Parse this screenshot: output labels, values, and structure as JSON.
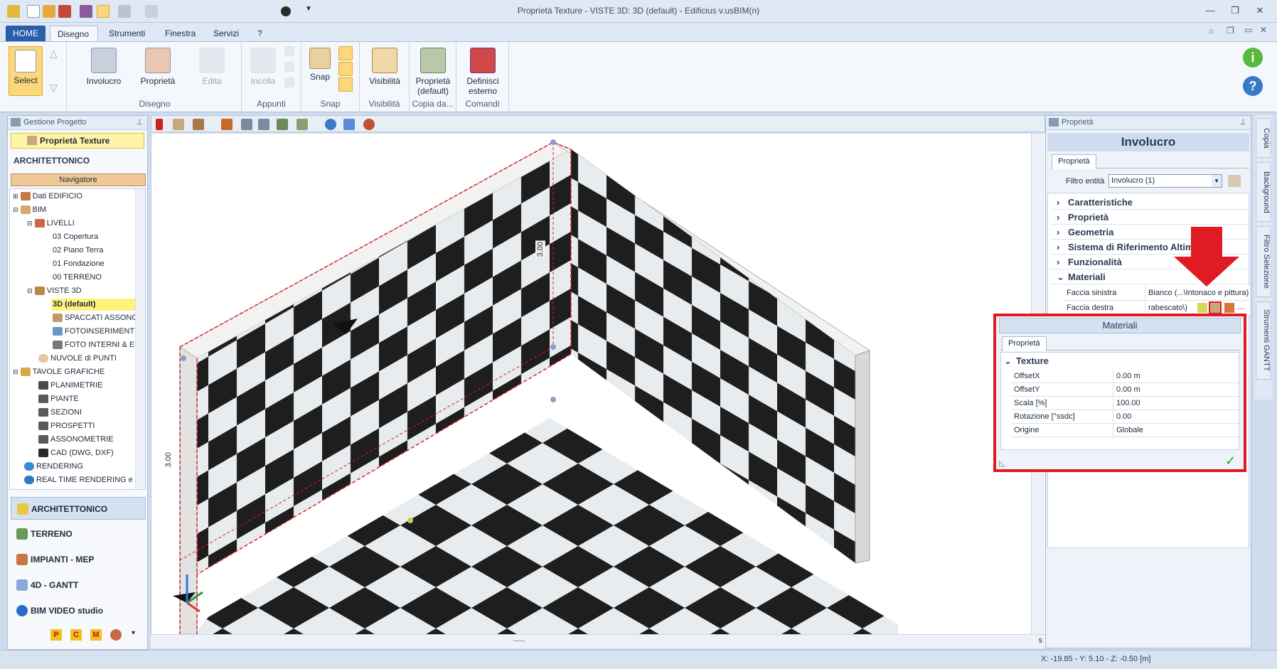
{
  "window": {
    "title": "Proprietà Texture -  VISTE 3D: 3D (default) - Edificius v.usBIM(n)"
  },
  "tabs": [
    "HOME",
    "Disegno",
    "Strumenti",
    "Finestra",
    "Servizi",
    "?"
  ],
  "ribbon": {
    "select_label": "Select",
    "disegno_group": {
      "involucro": "Involucro",
      "proprieta": "Proprietà",
      "edita": "Edita",
      "label": "Disegno"
    },
    "appunti_group": {
      "incolla": "Incolla",
      "label": "Appunti"
    },
    "snap_group": {
      "snap": "Snap",
      "label": "Snap"
    },
    "visibilita_group": {
      "visibilita": "Visibilità",
      "label": "Visibilità"
    },
    "copia_group": {
      "prop_default_1": "Proprietà",
      "prop_default_2": "(default)",
      "label": "Copia da..."
    },
    "comandi_group": {
      "def_1": "Definisci",
      "def_2": "esterno",
      "label": "Comandi"
    }
  },
  "left_panel": {
    "header": "Gestione Progetto",
    "active_doc": "Proprietà Texture",
    "section": "ARCHITETTONICO",
    "navigator": "Navigatore",
    "tree": [
      {
        "label": "Dati EDIFICIO"
      },
      {
        "label": "BIM"
      },
      {
        "label": "LIVELLI"
      },
      {
        "label": "03 Copertura"
      },
      {
        "label": "02 Piano Terra"
      },
      {
        "label": "01 Fondazione"
      },
      {
        "label": "00 TERRENO"
      },
      {
        "label": "VISTE 3D"
      },
      {
        "label": "3D (default)"
      },
      {
        "label": "SPACCATI ASSONO"
      },
      {
        "label": "FOTOINSERIMENTI"
      },
      {
        "label": "FOTO INTERNI & ES"
      },
      {
        "label": "NUVOLE di PUNTI"
      },
      {
        "label": "TAVOLE GRAFICHE"
      },
      {
        "label": "PLANIMETRIE"
      },
      {
        "label": "PIANTE"
      },
      {
        "label": "SEZIONI"
      },
      {
        "label": "PROSPETTI"
      },
      {
        "label": "ASSONOMETRIE"
      },
      {
        "label": "CAD (DWG, DXF)"
      },
      {
        "label": "RENDERING"
      },
      {
        "label": "REAL TIME RENDERING e VR"
      }
    ],
    "nav": [
      "ARCHITETTONICO",
      "TERRENO",
      "IMPIANTI - MEP",
      "4D - GANTT",
      "BIM VIDEO studio"
    ],
    "bottom_icons": [
      "P",
      "C",
      "M"
    ]
  },
  "viewport": {
    "dim_left": "3.00",
    "dim_right": "3.00"
  },
  "right_panel": {
    "header": "Proprietà",
    "title": "Involucro",
    "tab": "Proprietà",
    "filter_label": "Filtro entità",
    "filter_value": "Involucro (1)",
    "categories": [
      "Caratteristiche",
      "Proprietà",
      "Geometria",
      "Sistema di Riferimento Altimetrico",
      "Funzionalità",
      "Materiali"
    ],
    "materiali_rows": [
      {
        "key": "Faccia sinistra",
        "value": "Bianco   (...\\Intonaco e pittura)"
      },
      {
        "key": "Faccia destra",
        "value": "rabescato\\)"
      }
    ]
  },
  "side_tabs": [
    "Copia",
    "Background",
    "Filtro Selezione",
    "Strumenti GANTT"
  ],
  "materials_popup": {
    "title": "Materiali",
    "tab": "Proprietà",
    "category": "Texture",
    "rows": [
      {
        "key": "OffsetX",
        "value": "0.00 m"
      },
      {
        "key": "OffsetY",
        "value": "0.00 m"
      },
      {
        "key": "Scala  [%]",
        "value": "100.00"
      },
      {
        "key": "Rotazione  [°ssdc]",
        "value": "0.00"
      },
      {
        "key": "Origine",
        "value": "Globale"
      }
    ]
  },
  "status": {
    "coords": "X: -19.85 - Y: 5.10 - Z: -0.50 [m]",
    "scroll_label": "s"
  },
  "colors": {
    "accent": "#2a5ea8",
    "highlight": "#e01b24",
    "select_yellow": "#fbd779"
  }
}
